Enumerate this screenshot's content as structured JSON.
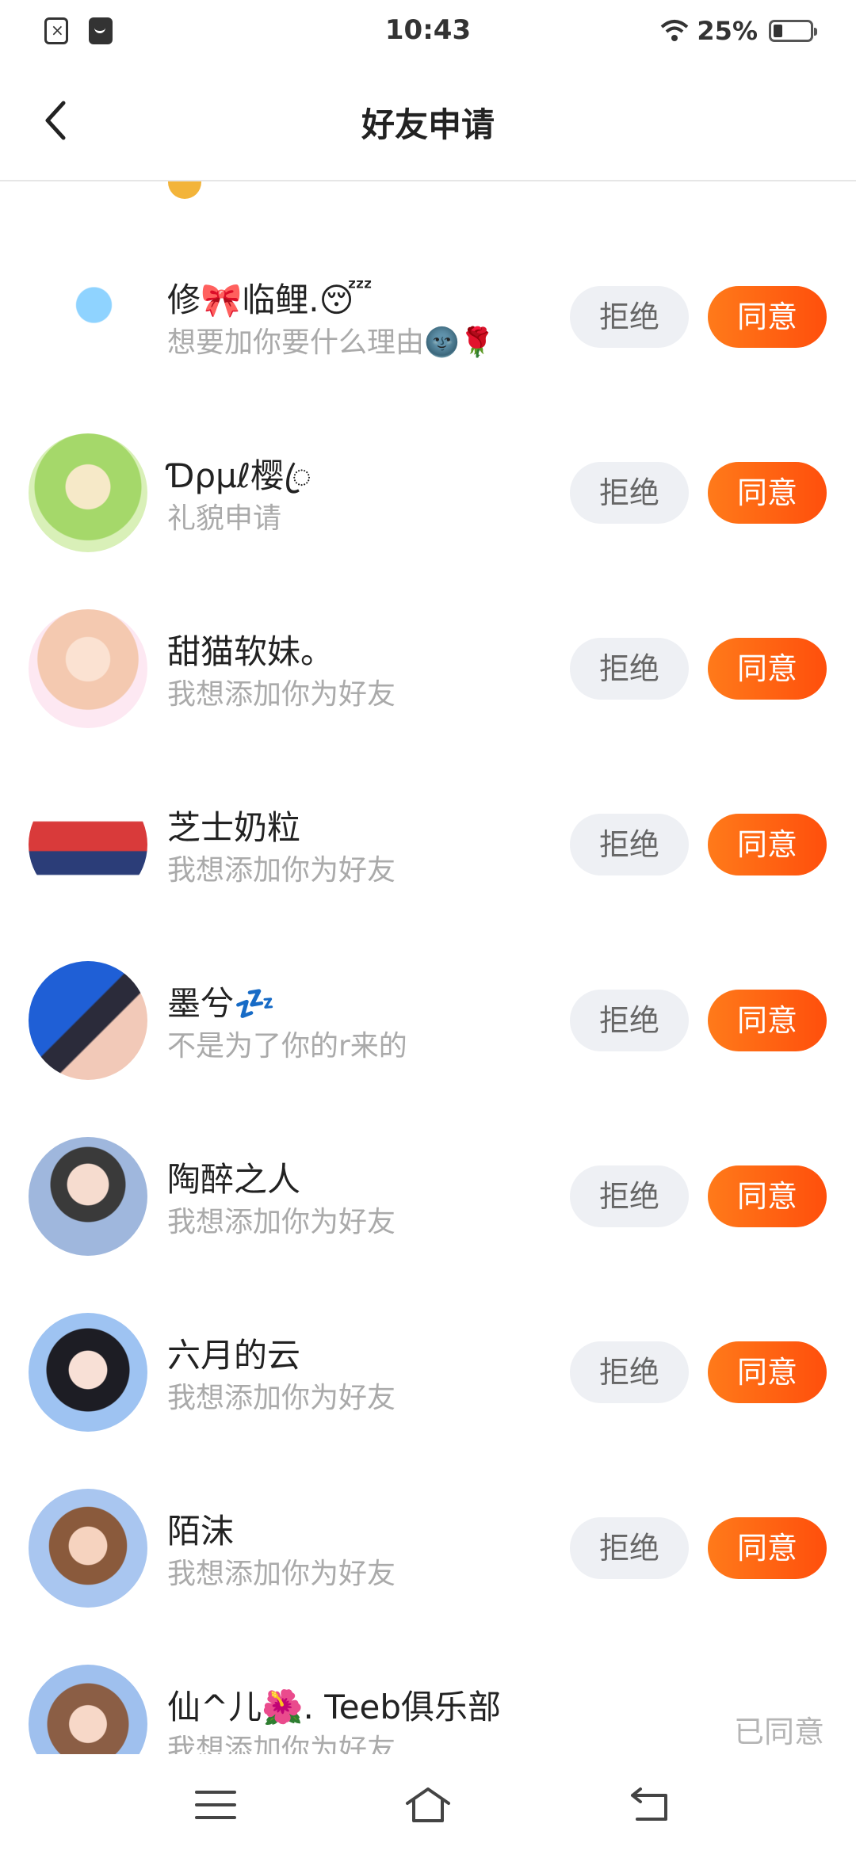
{
  "status_bar": {
    "time": "10:43",
    "battery": "25%",
    "battery_level": 0.25,
    "icons": [
      "sim-off-icon",
      "mail-icon",
      "wifi-icon",
      "battery-icon"
    ]
  },
  "header": {
    "title": "好友申请",
    "back_icon": "chevron-left-icon"
  },
  "colors": {
    "accent": "#ff5a10",
    "reject_bg": "#eef0f4",
    "secondary_text": "#aaaaaa"
  },
  "requests": [
    {
      "name": "修🎀临鲤.😴",
      "message": "想要加你要什么理由🌚🌹",
      "reject": "拒绝",
      "accept": "同意"
    },
    {
      "name": "Ɗρμℓ樱ꦿ",
      "message": "礼貌申请",
      "reject": "拒绝",
      "accept": "同意"
    },
    {
      "name": "甜猫软妹。",
      "message": "我想添加你为好友",
      "reject": "拒绝",
      "accept": "同意"
    },
    {
      "name": "芝士奶粒",
      "message": "我想添加你为好友",
      "reject": "拒绝",
      "accept": "同意"
    },
    {
      "name": "墨兮💤",
      "message": "不是为了你的r来的",
      "reject": "拒绝",
      "accept": "同意"
    },
    {
      "name": "陶醉之人",
      "message": "我想添加你为好友",
      "reject": "拒绝",
      "accept": "同意"
    },
    {
      "name": "六月的云",
      "message": "我想添加你为好友",
      "reject": "拒绝",
      "accept": "同意"
    },
    {
      "name": "陌沫",
      "message": "我想添加你为好友",
      "reject": "拒绝",
      "accept": "同意"
    },
    {
      "name": "仙^儿🌺. Teeb俱乐部",
      "message": "我想添加你为好友",
      "status": "已同意"
    }
  ],
  "nav_bar": {
    "icons": [
      "menu-icon",
      "home-icon",
      "back-icon"
    ]
  }
}
